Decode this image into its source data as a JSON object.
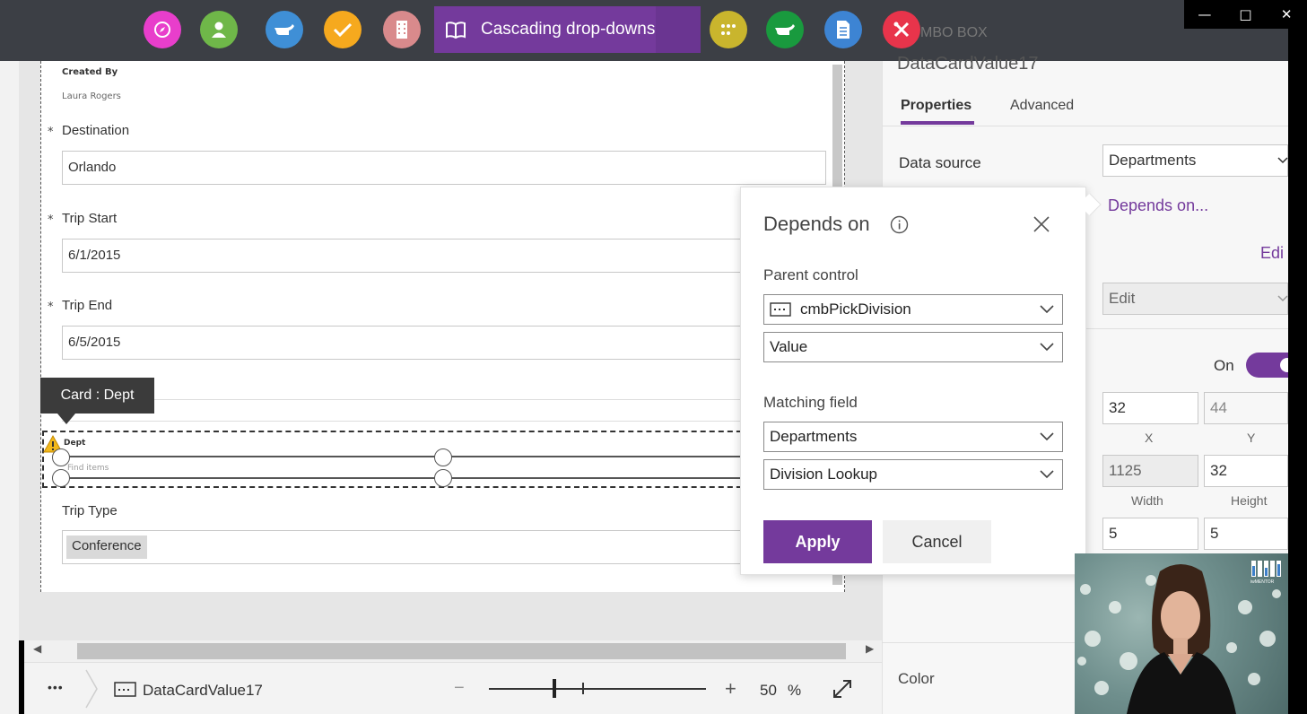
{
  "topbar": {
    "title": "Cascading drop-downs",
    "colors": {
      "bar": "#3c3f45",
      "title_pill": "#743a9c",
      "btn_magenta": "#e83ecb",
      "btn_green": "#6fb749",
      "btn_blue": "#3f8fd6",
      "btn_orange": "#f6a91e",
      "btn_rose": "#d98a8c",
      "btn_yellow": "#c9b52d",
      "btn_darkgreen": "#199a3e",
      "btn_doc_blue": "#3d84d3",
      "btn_red": "#e8344b"
    },
    "icons": [
      "compass-icon",
      "user-icon",
      "pointing-hand-icon",
      "check-icon",
      "building-icon",
      "book-icon",
      "grid-dots-icon",
      "pointing-hand-icon",
      "document-icon",
      "tools-icon"
    ]
  },
  "form": {
    "created_by_label": "Created By",
    "created_by_value": "Laura Rogers",
    "required_mark": "*",
    "destination": {
      "label": "Destination",
      "value": "Orlando"
    },
    "trip_start": {
      "label": "Trip Start",
      "value": "6/1/2015"
    },
    "trip_end": {
      "label": "Trip End",
      "value": "6/5/2015"
    },
    "tooltip": "Card : Dept",
    "dept": {
      "label": "Dept",
      "placeholder": "Find items"
    },
    "trip_type": {
      "label": "Trip Type",
      "value": "Conference"
    }
  },
  "bottombar": {
    "more": "•••",
    "control_name": "DataCardValue17",
    "zoom_minus": "−",
    "zoom_plus": "+",
    "zoom_value": "50",
    "zoom_unit": "%",
    "zoom_fraction": 0.3
  },
  "right_panel": {
    "control_type_partial": "MBO BOX",
    "control_name": "DataCardValue17",
    "tabs": {
      "properties": "Properties",
      "advanced": "Advanced"
    },
    "data_source_label": "Data source",
    "data_source_value": "Departments",
    "depends_on_link": "Depends on...",
    "edit_link_partial": "Edi",
    "mode_value": "Edit",
    "toggle_label": "On",
    "x": {
      "value": "32",
      "label": "X"
    },
    "y": {
      "value": "44",
      "label": "Y"
    },
    "width": {
      "value": "1125",
      "label": "Width"
    },
    "height": {
      "value": "32",
      "label": "Height"
    },
    "pad_a": "5",
    "pad_b": "5",
    "color_label": "Color"
  },
  "popup": {
    "title": "Depends on",
    "parent_control_label": "Parent control",
    "parent_control_value": "cmbPickDivision",
    "parent_field_value": "Value",
    "matching_field_label": "Matching field",
    "matching_source_value": "Departments",
    "matching_field_value": "Division Lookup",
    "apply_label": "Apply",
    "cancel_label": "Cancel"
  },
  "video": {
    "logo_text": "iwMENTOR"
  }
}
